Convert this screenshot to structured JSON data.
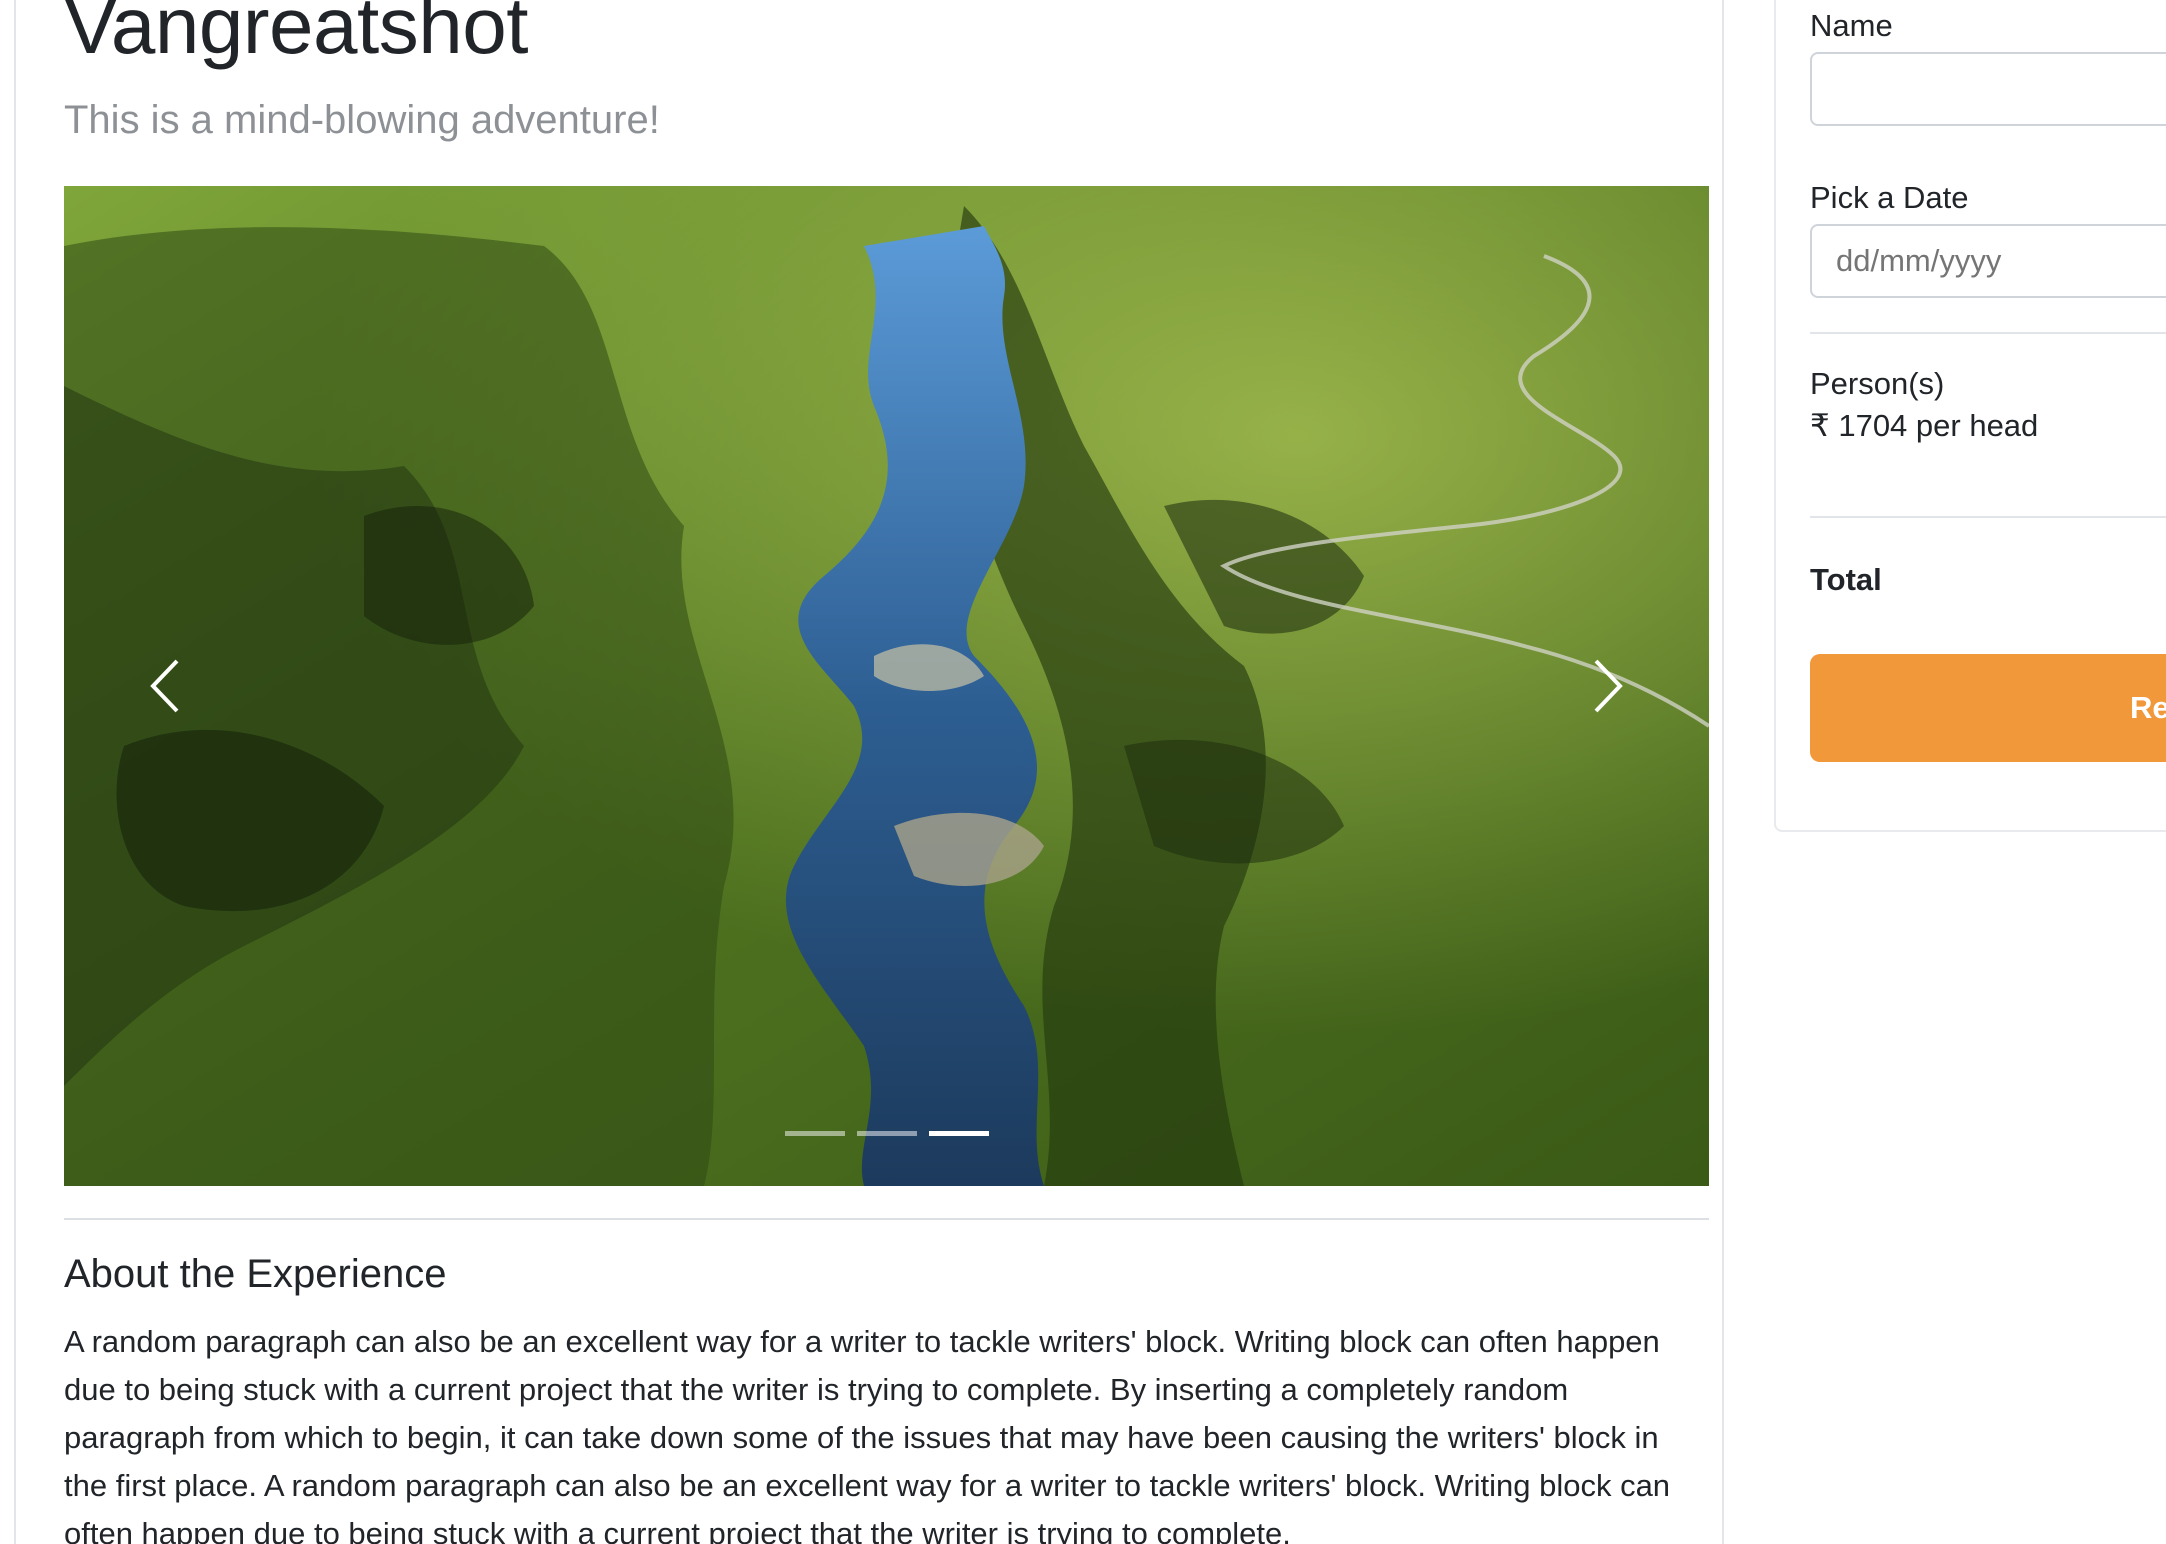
{
  "experience": {
    "title": "Vangreatshot",
    "subtitle": "This is a mind-blowing adventure!",
    "carousel": {
      "slide_count": 3,
      "active_index": 2
    },
    "about_heading": "About the Experience",
    "about_text": "A random paragraph can also be an excellent way for a writer to tackle writers' block. Writing block can often happen due to being stuck with a current project that the writer is trying to complete. By inserting a completely random paragraph from which to begin, it can take down some of the issues that may have been causing the writers' block in the first place. A random paragraph can also be an excellent way for a writer to tackle writers' block. Writing block can often happen due to being stuck with a current project that the writer is trying to complete."
  },
  "booking": {
    "name_label": "Name",
    "name_value": "",
    "date_label": "Pick a Date",
    "date_placeholder": "dd/mm/yyyy",
    "persons_label": "Person(s)",
    "price_per_head": "₹ 1704 per head",
    "total_label": "Total",
    "reserve_label": "Re"
  },
  "colors": {
    "accent": "#f0983a",
    "subtitle_gray": "#8d9196",
    "text": "#212529"
  }
}
